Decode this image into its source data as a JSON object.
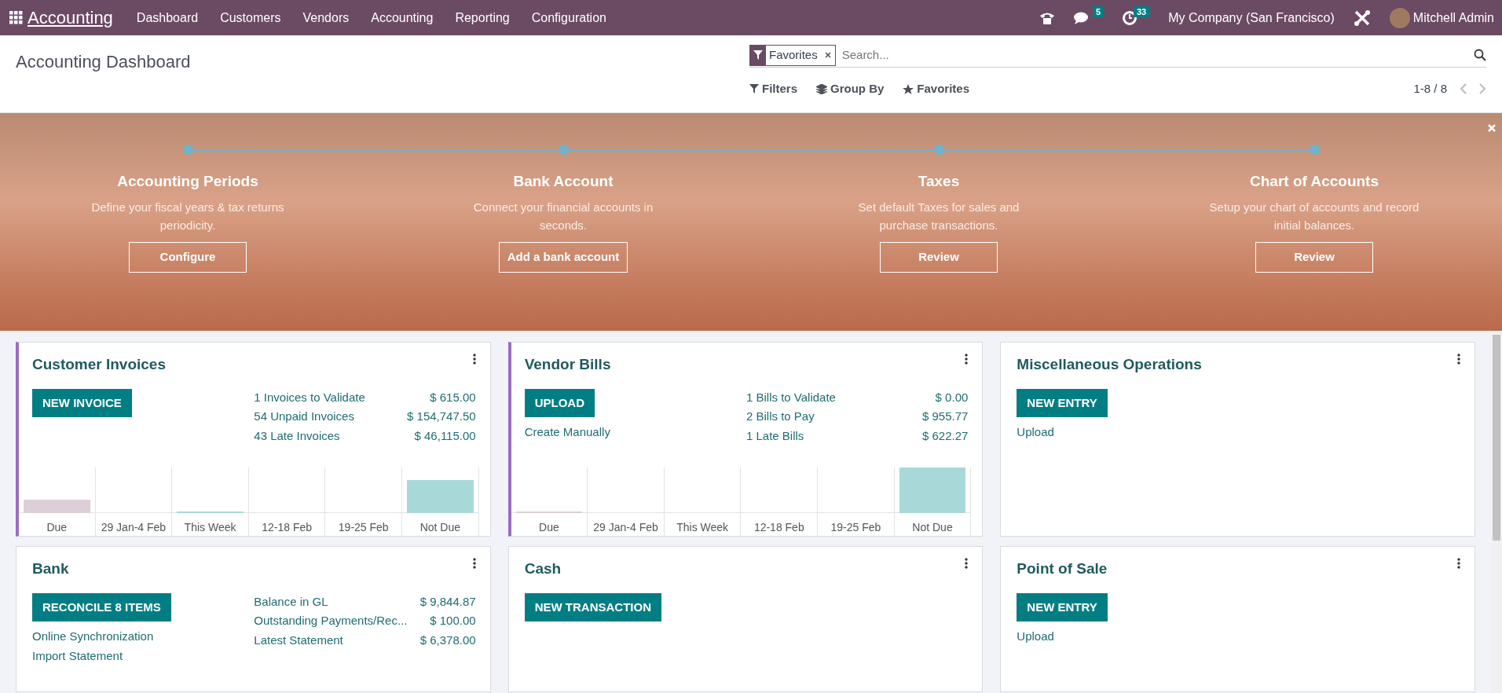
{
  "navbar": {
    "app_name": "Accounting",
    "menu": [
      {
        "label": "Dashboard"
      },
      {
        "label": "Customers"
      },
      {
        "label": "Vendors"
      },
      {
        "label": "Accounting"
      },
      {
        "label": "Reporting"
      },
      {
        "label": "Configuration"
      }
    ],
    "messages_count": "5",
    "activities_count": "33",
    "company": "My Company (San Francisco)",
    "user": "Mitchell Admin"
  },
  "control_panel": {
    "title": "Accounting Dashboard",
    "facet": "Favorites",
    "search_placeholder": "Search...",
    "filters": "Filters",
    "group_by": "Group By",
    "favorites": "Favorites",
    "pager": "1-8 / 8"
  },
  "onboarding": {
    "steps": [
      {
        "title": "Accounting Periods",
        "description": "Define your fiscal years & tax returns periodicity.",
        "button": "Configure"
      },
      {
        "title": "Bank Account",
        "description": "Connect your financial accounts in seconds.",
        "button": "Add a bank account"
      },
      {
        "title": "Taxes",
        "description": "Set default Taxes for sales and purchase transactions.",
        "button": "Review"
      },
      {
        "title": "Chart of Accounts",
        "description": "Setup your chart of accounts and record initial balances.",
        "button": "Review"
      }
    ]
  },
  "journals": [
    {
      "title": "Customer Invoices",
      "accent": true,
      "button": "NEW INVOICE",
      "stats": [
        {
          "label": "1 Invoices to Validate",
          "amount": "$ 615.00"
        },
        {
          "label": "54 Unpaid Invoices",
          "amount": "$ 154,747.50"
        },
        {
          "label": "43 Late Invoices",
          "amount": "$ 46,115.00"
        }
      ],
      "graph": [
        "Due",
        "29 Jan-4 Feb",
        "This Week",
        "12-18 Feb",
        "19-25 Feb",
        "Not Due"
      ]
    },
    {
      "title": "Vendor Bills",
      "accent": true,
      "button": "UPLOAD",
      "links": [
        "Create Manually"
      ],
      "stats": [
        {
          "label": "1 Bills to Validate",
          "amount": "$ 0.00"
        },
        {
          "label": "2 Bills to Pay",
          "amount": "$ 955.77"
        },
        {
          "label": "1 Late Bills",
          "amount": "$ 622.27"
        }
      ],
      "graph": [
        "Due",
        "29 Jan-4 Feb",
        "This Week",
        "12-18 Feb",
        "19-25 Feb",
        "Not Due"
      ]
    },
    {
      "title": "Miscellaneous Operations",
      "accent": false,
      "button": "NEW ENTRY",
      "links": [
        "Upload"
      ]
    },
    {
      "title": "Bank",
      "accent": false,
      "button": "RECONCILE 8 ITEMS",
      "links": [
        "Online Synchronization",
        "Import Statement"
      ],
      "stats": [
        {
          "label": "Balance in GL",
          "amount": "$ 9,844.87"
        },
        {
          "label": "Outstanding Payments/Rec...",
          "amount": "$ 100.00"
        },
        {
          "label": "Latest Statement",
          "amount": "$ 6,378.00"
        }
      ]
    },
    {
      "title": "Cash",
      "accent": false,
      "button": "NEW TRANSACTION"
    },
    {
      "title": "Point of Sale",
      "accent": false,
      "button": "NEW ENTRY",
      "links": [
        "Upload"
      ]
    }
  ]
}
